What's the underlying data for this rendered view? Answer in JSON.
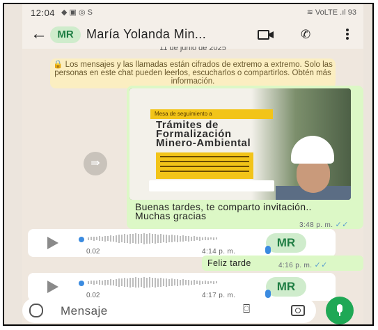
{
  "status_bar": {
    "time": "12:04",
    "icons": "◆ ▣ ◎ S",
    "right": "≋ VoLTE .ıl 93"
  },
  "header": {
    "avatar": "MR",
    "contact_name": "María Yolanda Min...",
    "back_icon": "arrow-left-icon",
    "video_icon": "video-icon",
    "call_icon": "phone-icon",
    "menu_icon": "more-vertical-icon"
  },
  "chat": {
    "date_chip": "11 de junio de 2025",
    "encryption_notice": "🔒 Los mensajes y las llamadas están cifrados de extremo a extremo. Solo las personas en este chat pueden leerlos, escucharlos o compartirlos. Obtén más información.",
    "image_message": {
      "poster_band": "Mesa de seguimiento a",
      "poster_title_lines": [
        "Trámites de",
        "Formalización",
        "Minero-Ambiental"
      ],
      "text": "Buenas tardes, te comparto invitación..\nMuchas gracias",
      "time": "3:48 p. m."
    },
    "audio_1": {
      "duration": "0.02",
      "time": "4:14 p. m.",
      "avatar": "MR"
    },
    "text_message": {
      "text": "Feliz tarde",
      "time": "4:16 p. m."
    },
    "audio_2": {
      "duration": "0.02",
      "time": "4:17 p. m.",
      "avatar": "MR"
    }
  },
  "composer": {
    "placeholder": "Mensaje"
  },
  "colors": {
    "accent": "#1fa855",
    "outgoing": "#dcf8c6",
    "ticks": "#5a9ecf"
  }
}
